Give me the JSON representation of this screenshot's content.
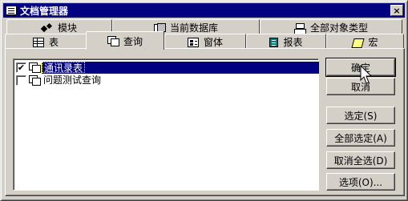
{
  "window": {
    "title": "文档管理器",
    "close_label": "×"
  },
  "tabs_back": [
    {
      "label": "模块",
      "icon": "module-icon"
    },
    {
      "label": "当前数据库",
      "icon": "database-icon"
    },
    {
      "label": "全部对象类型",
      "icon": "all-objects-icon"
    }
  ],
  "tabs_front": [
    {
      "label": "表",
      "icon": "table-icon"
    },
    {
      "label": "查询",
      "icon": "query-icon",
      "active": true
    },
    {
      "label": "窗体",
      "icon": "form-icon"
    },
    {
      "label": "报表",
      "icon": "report-icon"
    },
    {
      "label": "宏",
      "icon": "macro-icon"
    }
  ],
  "list": {
    "items": [
      {
        "label": "通讯录表",
        "checked": true,
        "selected": true,
        "check_mark": "✔"
      },
      {
        "label": "问题测试查询",
        "checked": false,
        "selected": false,
        "check_mark": ""
      }
    ]
  },
  "buttons": {
    "ok": "确定",
    "cancel": "取消",
    "select": "选定(S)",
    "select_all": "全部选定(A)",
    "deselect_all": "取消全选(D)",
    "options": "选项(O)..."
  }
}
